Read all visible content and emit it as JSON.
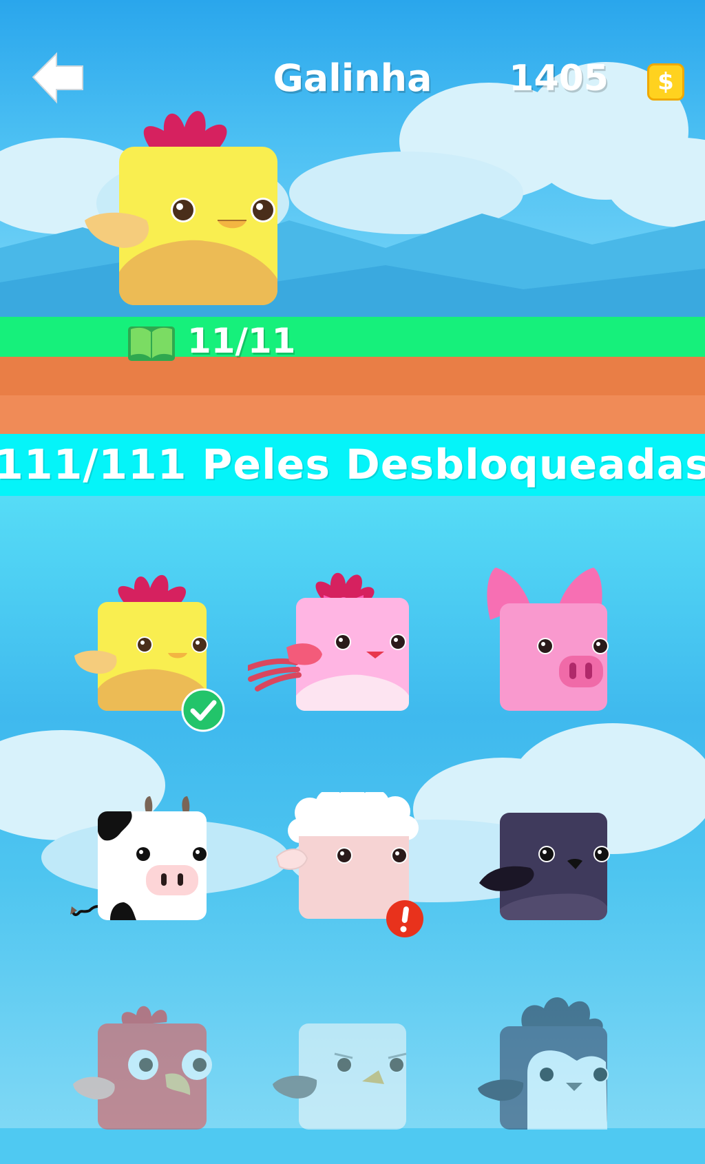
{
  "header": {
    "title": "Galinha",
    "coins": "1405",
    "coin_symbol": "$"
  },
  "preview": {
    "progress": "11/11"
  },
  "banner": {
    "unlocked_text": "111/111 Peles Desbloqueadas"
  },
  "skins": [
    {
      "name": "chicken",
      "selected": true
    },
    {
      "name": "pink-bird"
    },
    {
      "name": "pig"
    },
    {
      "name": "cow"
    },
    {
      "name": "sheep",
      "alert": "!"
    },
    {
      "name": "crow"
    },
    {
      "name": "parrot"
    },
    {
      "name": "eagle"
    },
    {
      "name": "penguin"
    }
  ],
  "colors": {
    "grass": "#16f07b",
    "dirt": "#e97e46",
    "banner": "#05f4f9",
    "selected_check": "#22c46a",
    "alert": "#e8321c",
    "coin": "#ffd21f"
  }
}
